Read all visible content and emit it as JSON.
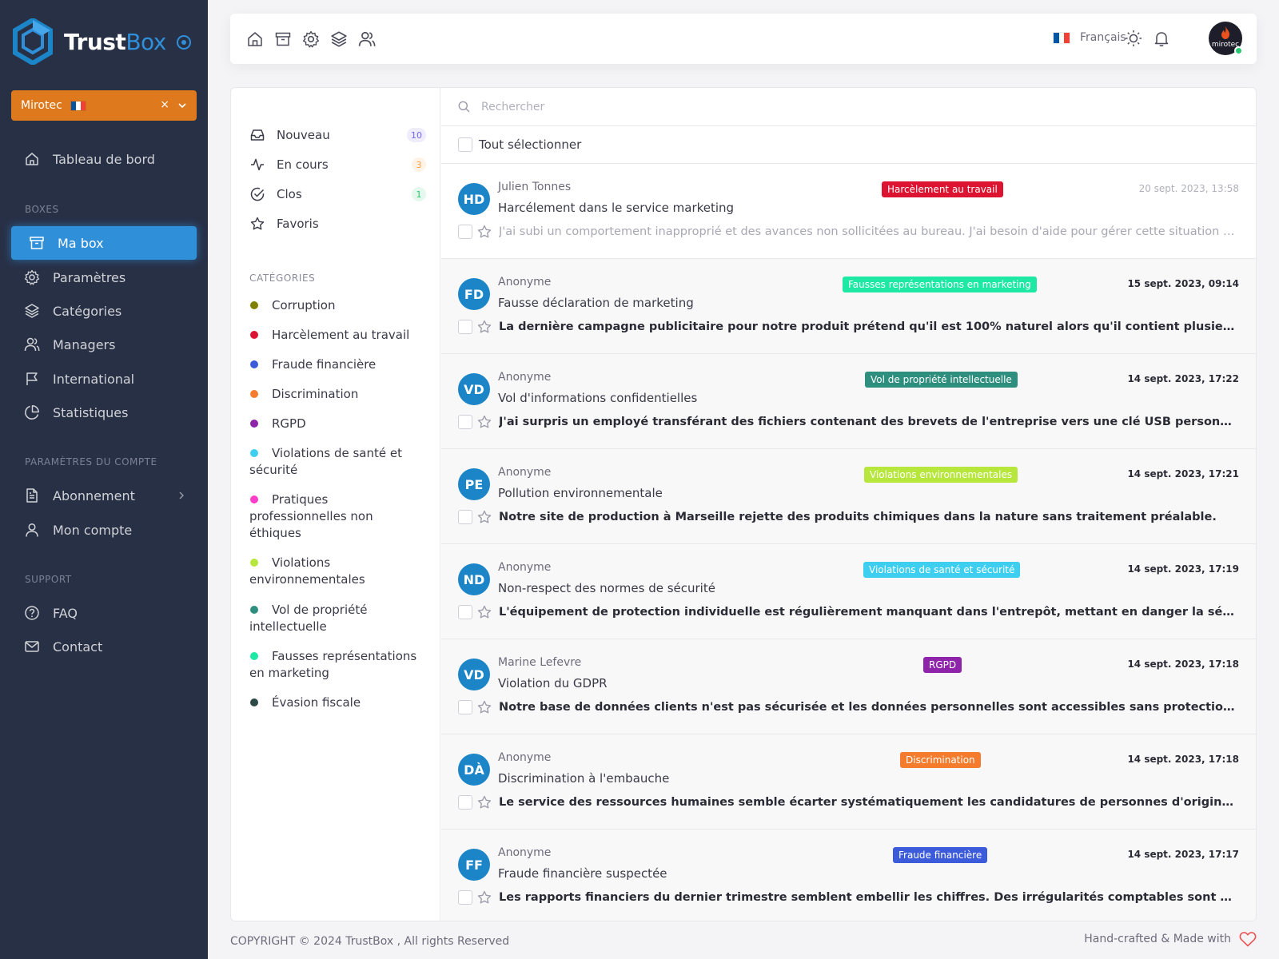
{
  "brand": {
    "name_bold": "Trust",
    "name_light": "Box"
  },
  "org": {
    "name": "Mirotec",
    "clear": "×"
  },
  "sidebar": {
    "dashboard": "Tableau de bord",
    "boxes_head": "BOXES",
    "boxes": [
      "Ma box",
      "Paramètres",
      "Catégories",
      "Managers",
      "International",
      "Statistiques"
    ],
    "account_head": "PARAMÈTRES DU COMPTE",
    "account": [
      "Abonnement",
      "Mon compte"
    ],
    "support_head": "SUPPORT",
    "support": [
      "FAQ",
      "Contact"
    ]
  },
  "topbar": {
    "language": "Français",
    "avatar_text": "mirotec"
  },
  "filters": [
    {
      "label": "Nouveau",
      "count": "10",
      "color": "#7367f0",
      "bg": "#eeecfd"
    },
    {
      "label": "En cours",
      "count": "3",
      "color": "#ff9f43",
      "bg": "#fff3e8"
    },
    {
      "label": "Clos",
      "count": "1",
      "color": "#28c76f",
      "bg": "#e5f8ed"
    },
    {
      "label": "Favoris",
      "count": "",
      "color": "",
      "bg": ""
    }
  ],
  "categories_head": "CATÉGORIES",
  "categories": [
    {
      "label": "Corruption",
      "color": "#808000"
    },
    {
      "label": "Harcèlement au travail",
      "color": "#dc1432"
    },
    {
      "label": "Fraude financière",
      "color": "#3b5bdb"
    },
    {
      "label": "Discrimination",
      "color": "#f47c2c"
    },
    {
      "label": "RGPD",
      "color": "#8e24aa"
    },
    {
      "label": "Violations de santé et sécurité",
      "color": "#3ecff0"
    },
    {
      "label": "Pratiques professionnelles non éthiques",
      "color": "#ff3dca"
    },
    {
      "label": "Violations environnementales",
      "color": "#b7e63c"
    },
    {
      "label": "Vol de propriété intellectuelle",
      "color": "#2f8f7f"
    },
    {
      "label": "Fausses représentations en marketing",
      "color": "#1de9a5"
    },
    {
      "label": "Évasion fiscale",
      "color": "#2c4a45"
    }
  ],
  "search": {
    "placeholder": "Rechercher"
  },
  "select_all": "Tout sélectionner",
  "messages": [
    {
      "initials": "HD",
      "sender": "Julien Tonnes",
      "subject": "Harcélement dans le service marketing",
      "tag": "Harcèlement au travail",
      "tag_color": "#dc1432",
      "date": "20 sept. 2023, 13:58",
      "preview": "J'ai subi un comportement inapproprié et des avances non sollicitées au bureau. J'ai besoin d'aide pour gérer cette situation et p..."
    },
    {
      "initials": "FD",
      "sender": "Anonyme",
      "subject": "Fausse déclaration de marketing",
      "tag": "Fausses représentations en marketing",
      "tag_color": "#1de9a5",
      "date": "15 sept. 2023, 09:14",
      "preview": "La dernière campagne publicitaire pour notre produit prétend qu'il est 100% naturel alors qu'il contient plusieurs additifs syn..."
    },
    {
      "initials": "VD",
      "sender": "Anonyme",
      "subject": "Vol d'informations confidentielles",
      "tag": "Vol de propriété intellectuelle",
      "tag_color": "#2f8f7f",
      "date": "14 sept. 2023, 17:22",
      "preview": "J'ai surpris un employé transférant des fichiers contenant des brevets de l'entreprise vers une clé USB personnelle."
    },
    {
      "initials": "PE",
      "sender": "Anonyme",
      "subject": "Pollution environnementale",
      "tag": "Violations environnementales",
      "tag_color": "#b7e63c",
      "date": "14 sept. 2023, 17:21",
      "preview": "Notre site de production à Marseille rejette des produits chimiques dans la nature sans traitement préalable."
    },
    {
      "initials": "ND",
      "sender": "Anonyme",
      "subject": "Non-respect des normes de sécurité",
      "tag": "Violations de santé et sécurité",
      "tag_color": "#3ecff0",
      "date": "14 sept. 2023, 17:19",
      "preview": "L'équipement de protection individuelle est régulièrement manquant dans l'entrepôt, mettant en danger la sécurité des em..."
    },
    {
      "initials": "VD",
      "sender": "Marine Lefevre",
      "subject": "Violation du GDPR",
      "tag": "RGPD",
      "tag_color": "#8e24aa",
      "date": "14 sept. 2023, 17:18",
      "preview": "Notre base de données clients n'est pas sécurisée et les données personnelles sont accessibles sans protection adéquate."
    },
    {
      "initials": "DÀ",
      "sender": "Anonyme",
      "subject": "Discrimination à l'embauche",
      "tag": "Discrimination",
      "tag_color": "#f47c2c",
      "date": "14 sept. 2023, 17:18",
      "preview": "Le service des ressources humaines semble écarter systématiquement les candidatures de personnes d'origine étrangère."
    },
    {
      "initials": "FF",
      "sender": "Anonyme",
      "subject": "Fraude financière suspectée",
      "tag": "Fraude financière",
      "tag_color": "#3b5bdb",
      "date": "14 sept. 2023, 17:17",
      "preview": "Les rapports financiers du dernier trimestre semblent embellir les chiffres. Des irrégularités comptables sont apparentes."
    }
  ],
  "footer": {
    "copyright": "COPYRIGHT © 2024 TrustBox , All rights Reserved",
    "made": "Hand-crafted & Made with"
  }
}
